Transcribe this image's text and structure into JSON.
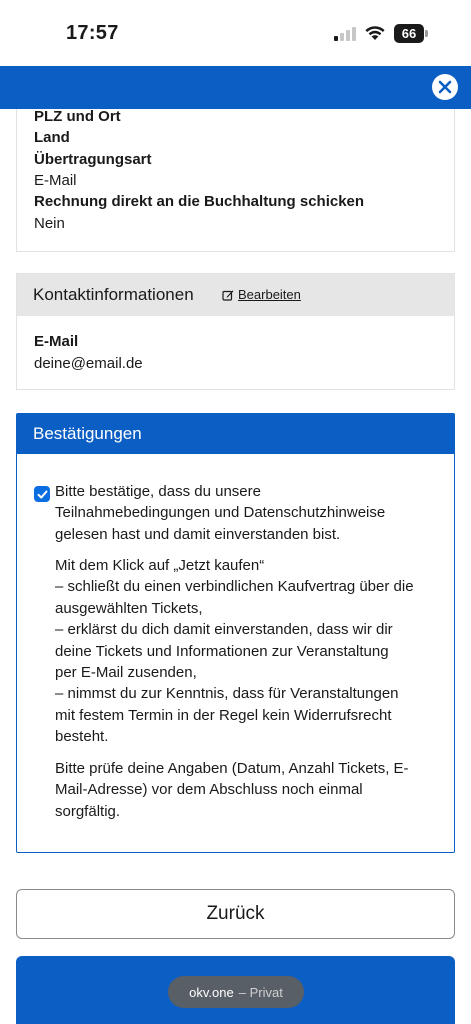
{
  "status_bar": {
    "time": "17:57",
    "battery": "66"
  },
  "colors": {
    "accent": "#0b5ec3",
    "checkbox": "#0b6ee0",
    "panel_header_gray": "#e6e6e6"
  },
  "billing_details": {
    "rows": [
      {
        "label": "PLZ und Ort"
      },
      {
        "label": "Land"
      },
      {
        "label": "Übertragungsart",
        "value": "E-Mail"
      },
      {
        "label": "Rechnung direkt an die Buchhaltung schicken",
        "value": "Nein"
      }
    ]
  },
  "contact": {
    "title": "Kontaktinformationen",
    "edit_label": "Bearbeiten",
    "email_label": "E-Mail",
    "email_value": "deine@email.de"
  },
  "confirmations": {
    "title": "Bestätigungen",
    "checkbox_checked": true,
    "consent_lines": [
      "Bitte bestätige, dass du unsere",
      "Teilnahmebedingungen und Datenschutzhinweise",
      "gelesen hast und damit einverstanden bist."
    ],
    "purchase_lines": [
      "Mit dem Klick auf „Jetzt kaufen“",
      "– schließt du einen verbindlichen Kaufvertrag über die",
      "ausgewählten Tickets,",
      "– erklärst du dich damit einverstanden, dass wir dir",
      "deine Tickets und Informationen zur Veranstaltung",
      "per E-Mail zusenden,",
      "– nimmst du zur Kenntnis, dass für Veranstaltungen",
      "mit festem Termin in der Regel kein Widerrufsrecht",
      "besteht."
    ],
    "check_lines": [
      "Bitte prüfe deine Angaben (Datum, Anzahl Tickets, E-",
      "Mail-Adresse) vor dem Abschluss noch einmal",
      "sorgfältig."
    ]
  },
  "buttons": {
    "back_label": "Zurück"
  },
  "browser": {
    "host": "okv.one",
    "mode": "– Privat"
  },
  "icons": {
    "close": "close-icon",
    "edit": "edit-icon",
    "check": "check-icon",
    "wifi": "wifi-icon",
    "signal": "cellular-signal-icon"
  }
}
